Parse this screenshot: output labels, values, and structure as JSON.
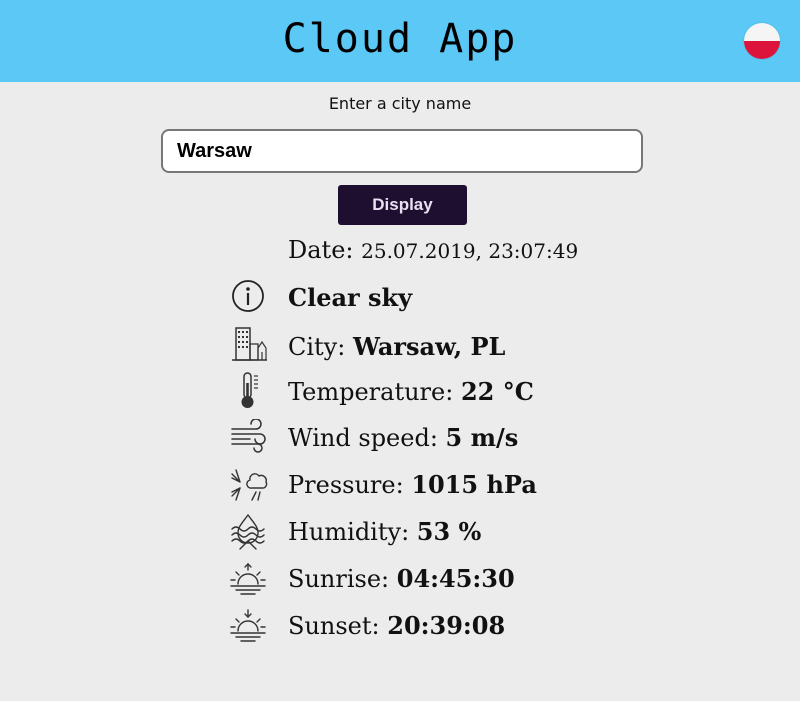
{
  "header": {
    "title": "Cloud App",
    "flag_icon": "poland-flag-icon",
    "background_color": "#5bc8f5"
  },
  "search": {
    "prompt": "Enter a city name",
    "value": "Warsaw",
    "placeholder": ""
  },
  "display_button": {
    "label": "Display",
    "color": "#1e0f30"
  },
  "weather": {
    "date_label": "Date:",
    "date_value": "25.07.2019, 23:07:49",
    "description": "Clear sky",
    "city_label": "City:",
    "city_value": "Warsaw, PL",
    "temperature_label": "Temperature:",
    "temperature_value": "22 °C",
    "wind_label": "Wind speed:",
    "wind_value": "5 m/s",
    "pressure_label": "Pressure:",
    "pressure_value": "1015 hPa",
    "humidity_label": "Humidity:",
    "humidity_value": "53 %",
    "sunrise_label": "Sunrise:",
    "sunrise_value": "04:45:30",
    "sunset_label": "Sunset:",
    "sunset_value": "20:39:08"
  }
}
